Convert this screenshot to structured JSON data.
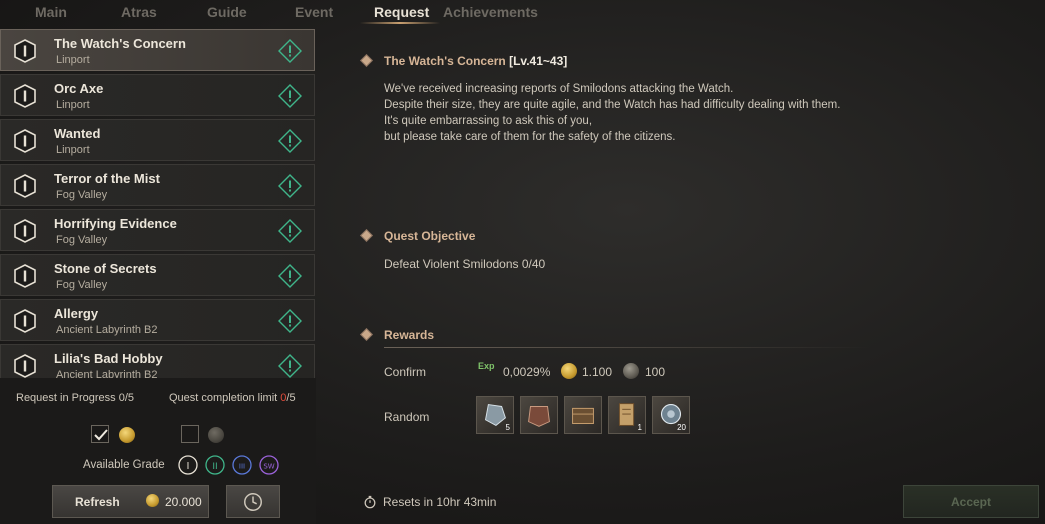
{
  "tabs": [
    {
      "label": "Main"
    },
    {
      "label": "Atras"
    },
    {
      "label": "Guide"
    },
    {
      "label": "Event"
    },
    {
      "label": "Request",
      "active": true
    },
    {
      "label": "Achievements"
    }
  ],
  "quests": [
    {
      "title": "The Watch's Concern",
      "location": "Linport",
      "grade": "I",
      "selected": true
    },
    {
      "title": "Orc Axe",
      "location": "Linport",
      "grade": "I"
    },
    {
      "title": "Wanted",
      "location": "Linport",
      "grade": "I"
    },
    {
      "title": "Terror of the Mist",
      "location": "Fog Valley",
      "grade": "I"
    },
    {
      "title": "Horrifying Evidence",
      "location": "Fog Valley",
      "grade": "I"
    },
    {
      "title": "Stone of Secrets",
      "location": "Fog Valley",
      "grade": "I"
    },
    {
      "title": "Allergy",
      "location": "Ancient Labyrinth B2",
      "grade": "I"
    },
    {
      "title": "Lilia's Bad Hobby",
      "location": "Ancient Labyrinth B2",
      "grade": "I"
    }
  ],
  "progress": {
    "request_label": "Request in Progress",
    "request_value": "0/5",
    "limit_label": "Quest completion limit",
    "limit_current": "0",
    "limit_total": "/5"
  },
  "filters": {
    "available_grade_label": "Available Grade",
    "grades": [
      "I",
      "II",
      "III",
      "SW"
    ]
  },
  "refresh": {
    "label": "Refresh",
    "cost": "20.000"
  },
  "detail": {
    "title": "The Watch's Concern",
    "level": "[Lv.41~43]",
    "description": [
      "We've received increasing reports of Smilodons attacking the Watch.",
      "Despite their size, they are quite agile, and the Watch has had difficulty dealing with them.",
      "It's quite embarrassing to ask this of you,",
      "but please take care of them for the safety of the citizens."
    ],
    "objective_title": "Quest Objective",
    "objective_text": "Defeat Violent Smilodons",
    "objective_count": "0/40",
    "rewards_title": "Rewards",
    "confirm_label": "Confirm",
    "confirm_rewards": {
      "exp": "0,0029%",
      "gold": "1.100",
      "silver": "100"
    },
    "exp_icon_text": "Exp",
    "random_label": "Random",
    "random_rewards": [
      {
        "icon": "ore-icon",
        "count": "5"
      },
      {
        "icon": "armor-box-icon",
        "count": ""
      },
      {
        "icon": "chest-icon",
        "count": ""
      },
      {
        "icon": "scroll-icon",
        "count": "1"
      },
      {
        "icon": "crystal-icon",
        "count": "20"
      }
    ],
    "reset_text": "Resets in 10hr 43min"
  },
  "accept_label": "Accept",
  "colors": {
    "accent": "#d7b697",
    "alert": "#3fb58a",
    "limit_red": "#e04a3a"
  }
}
